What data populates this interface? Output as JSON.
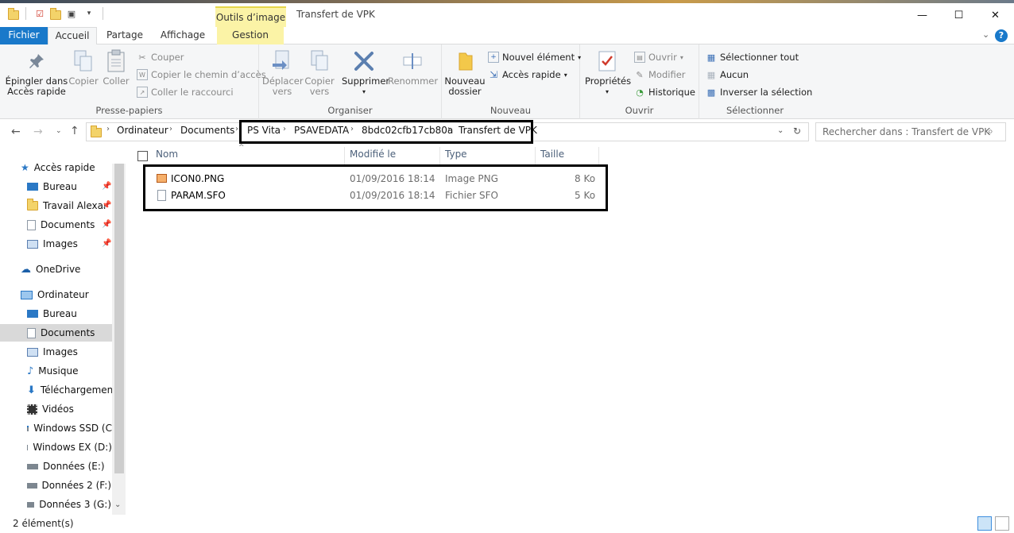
{
  "window": {
    "title": "Transfert de VPK",
    "contextual_tab": "Outils d’image",
    "minimize": "—",
    "maximize": "☐",
    "close": "✕"
  },
  "ribbon_tabs": [
    {
      "label": "Fichier"
    },
    {
      "label": "Accueil"
    },
    {
      "label": "Partage"
    },
    {
      "label": "Affichage"
    },
    {
      "label": "Gestion"
    }
  ],
  "groups": {
    "clipboard": {
      "label": "Presse-papiers",
      "pin": "Épingler dans\nAccès rapide",
      "pin_l1": "Épingler dans",
      "pin_l2": "Accès rapide",
      "copy": "Copier",
      "paste": "Coller",
      "cut": "Couper",
      "copy_path": "Copier le chemin d’accès",
      "paste_shortcut": "Coller le raccourci"
    },
    "organize": {
      "label": "Organiser",
      "move_l1": "Déplacer",
      "move_l2": "vers",
      "copyto_l1": "Copier",
      "copyto_l2": "vers",
      "delete": "Supprimer",
      "rename": "Renommer"
    },
    "new": {
      "label": "Nouveau",
      "folder_l1": "Nouveau",
      "folder_l2": "dossier",
      "new_item": "Nouvel élément",
      "quick_access": "Accès rapide"
    },
    "open": {
      "label": "Ouvrir",
      "properties": "Propriétés",
      "open": "Ouvrir",
      "edit": "Modifier",
      "history": "Historique"
    },
    "select": {
      "label": "Sélectionner",
      "all": "Sélectionner tout",
      "none": "Aucun",
      "invert": "Inverser la sélection"
    }
  },
  "address": {
    "crumbs": [
      "Ordinateur",
      "Documents",
      "PS Vita",
      "PSAVEDATA",
      "8bdc02cfb17cb80a",
      "Transfert de VPK"
    ],
    "search_placeholder": "Rechercher dans : Transfert de VPK"
  },
  "nav": {
    "quick_access": "Accès rapide",
    "qa_items": [
      "Bureau",
      "Travail Alexar",
      "Documents",
      "Images"
    ],
    "onedrive": "OneDrive",
    "computer": "Ordinateur",
    "pc_items": [
      "Bureau",
      "Documents",
      "Images",
      "Musique",
      "Téléchargement",
      "Vidéos",
      "Windows SSD (C",
      "Windows EX (D:)",
      "Données (E:)",
      "Données 2 (F:)",
      "Données 3 (G:)"
    ]
  },
  "columns": {
    "name": "Nom",
    "modified": "Modifié le",
    "type": "Type",
    "size": "Taille"
  },
  "files": [
    {
      "name": "ICON0.PNG",
      "modified": "01/09/2016 18:14",
      "type": "Image PNG",
      "size": "8 Ko"
    },
    {
      "name": "PARAM.SFO",
      "modified": "01/09/2016 18:14",
      "type": "Fichier SFO",
      "size": "5 Ko"
    }
  ],
  "status": {
    "count": "2 élément(s)"
  },
  "colors": {
    "accent": "#1979ca",
    "contextual": "#fbf3a6",
    "column_header": "#4c607a"
  }
}
